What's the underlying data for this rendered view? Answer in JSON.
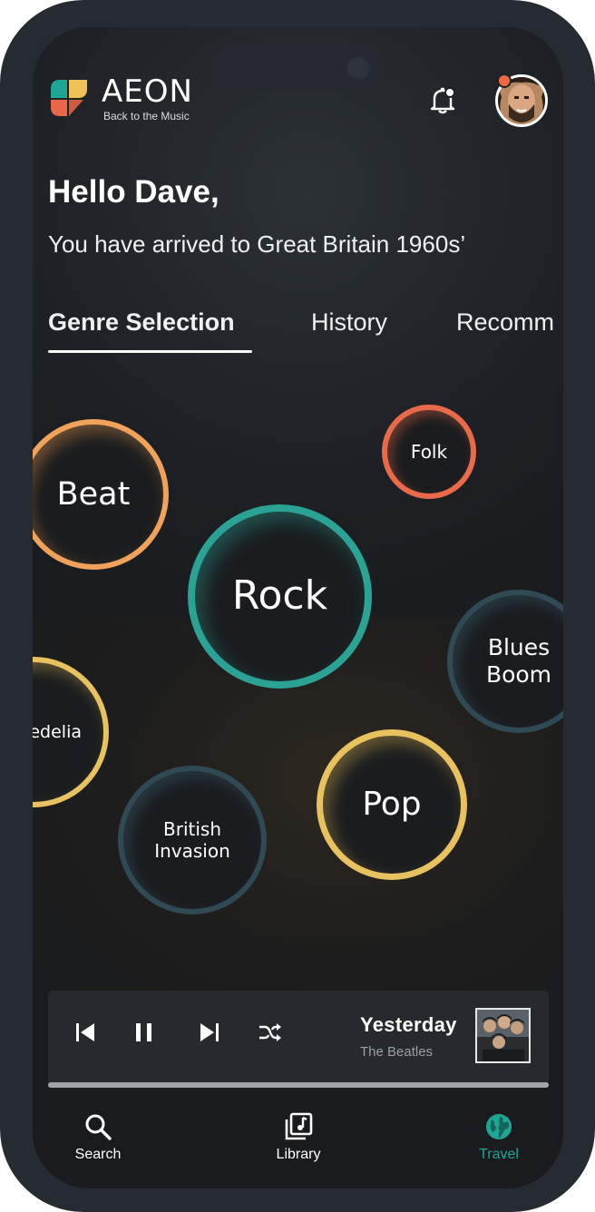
{
  "brand": {
    "name": "AEON",
    "tagline": "Back to the Music"
  },
  "header": {
    "bell_icon": "notification-bell-icon",
    "has_notification": true
  },
  "greeting": {
    "title": "Hello Dave,",
    "subtitle": "You have arrived to Great Britain 1960s’"
  },
  "tabs": [
    {
      "label": "Genre Selection",
      "active": true
    },
    {
      "label": "History",
      "active": false
    },
    {
      "label": "Recomm",
      "active": false
    }
  ],
  "genres": [
    {
      "label": "Beat",
      "color": "#f0a25a"
    },
    {
      "label": "Folk",
      "color": "#e86a4a"
    },
    {
      "label": "Rock",
      "color": "#2aa294"
    },
    {
      "label": "Blues Boom",
      "color": "#2f4a55"
    },
    {
      "label": "edelia",
      "color": "#e8c25e"
    },
    {
      "label": "Pop",
      "color": "#e8c25e"
    },
    {
      "label": "British Invasion",
      "color": "#2f4a55"
    }
  ],
  "player": {
    "song": "Yesterday",
    "artist": "The Beatles",
    "controls": [
      "skip-previous-icon",
      "pause-icon",
      "skip-next-icon",
      "shuffle-icon"
    ]
  },
  "nav": [
    {
      "label": "Search",
      "icon": "search-icon",
      "active": false
    },
    {
      "label": "Library",
      "icon": "library-icon",
      "active": false
    },
    {
      "label": "Travel",
      "icon": "globe-icon",
      "active": true,
      "color": "#1fa594"
    }
  ]
}
